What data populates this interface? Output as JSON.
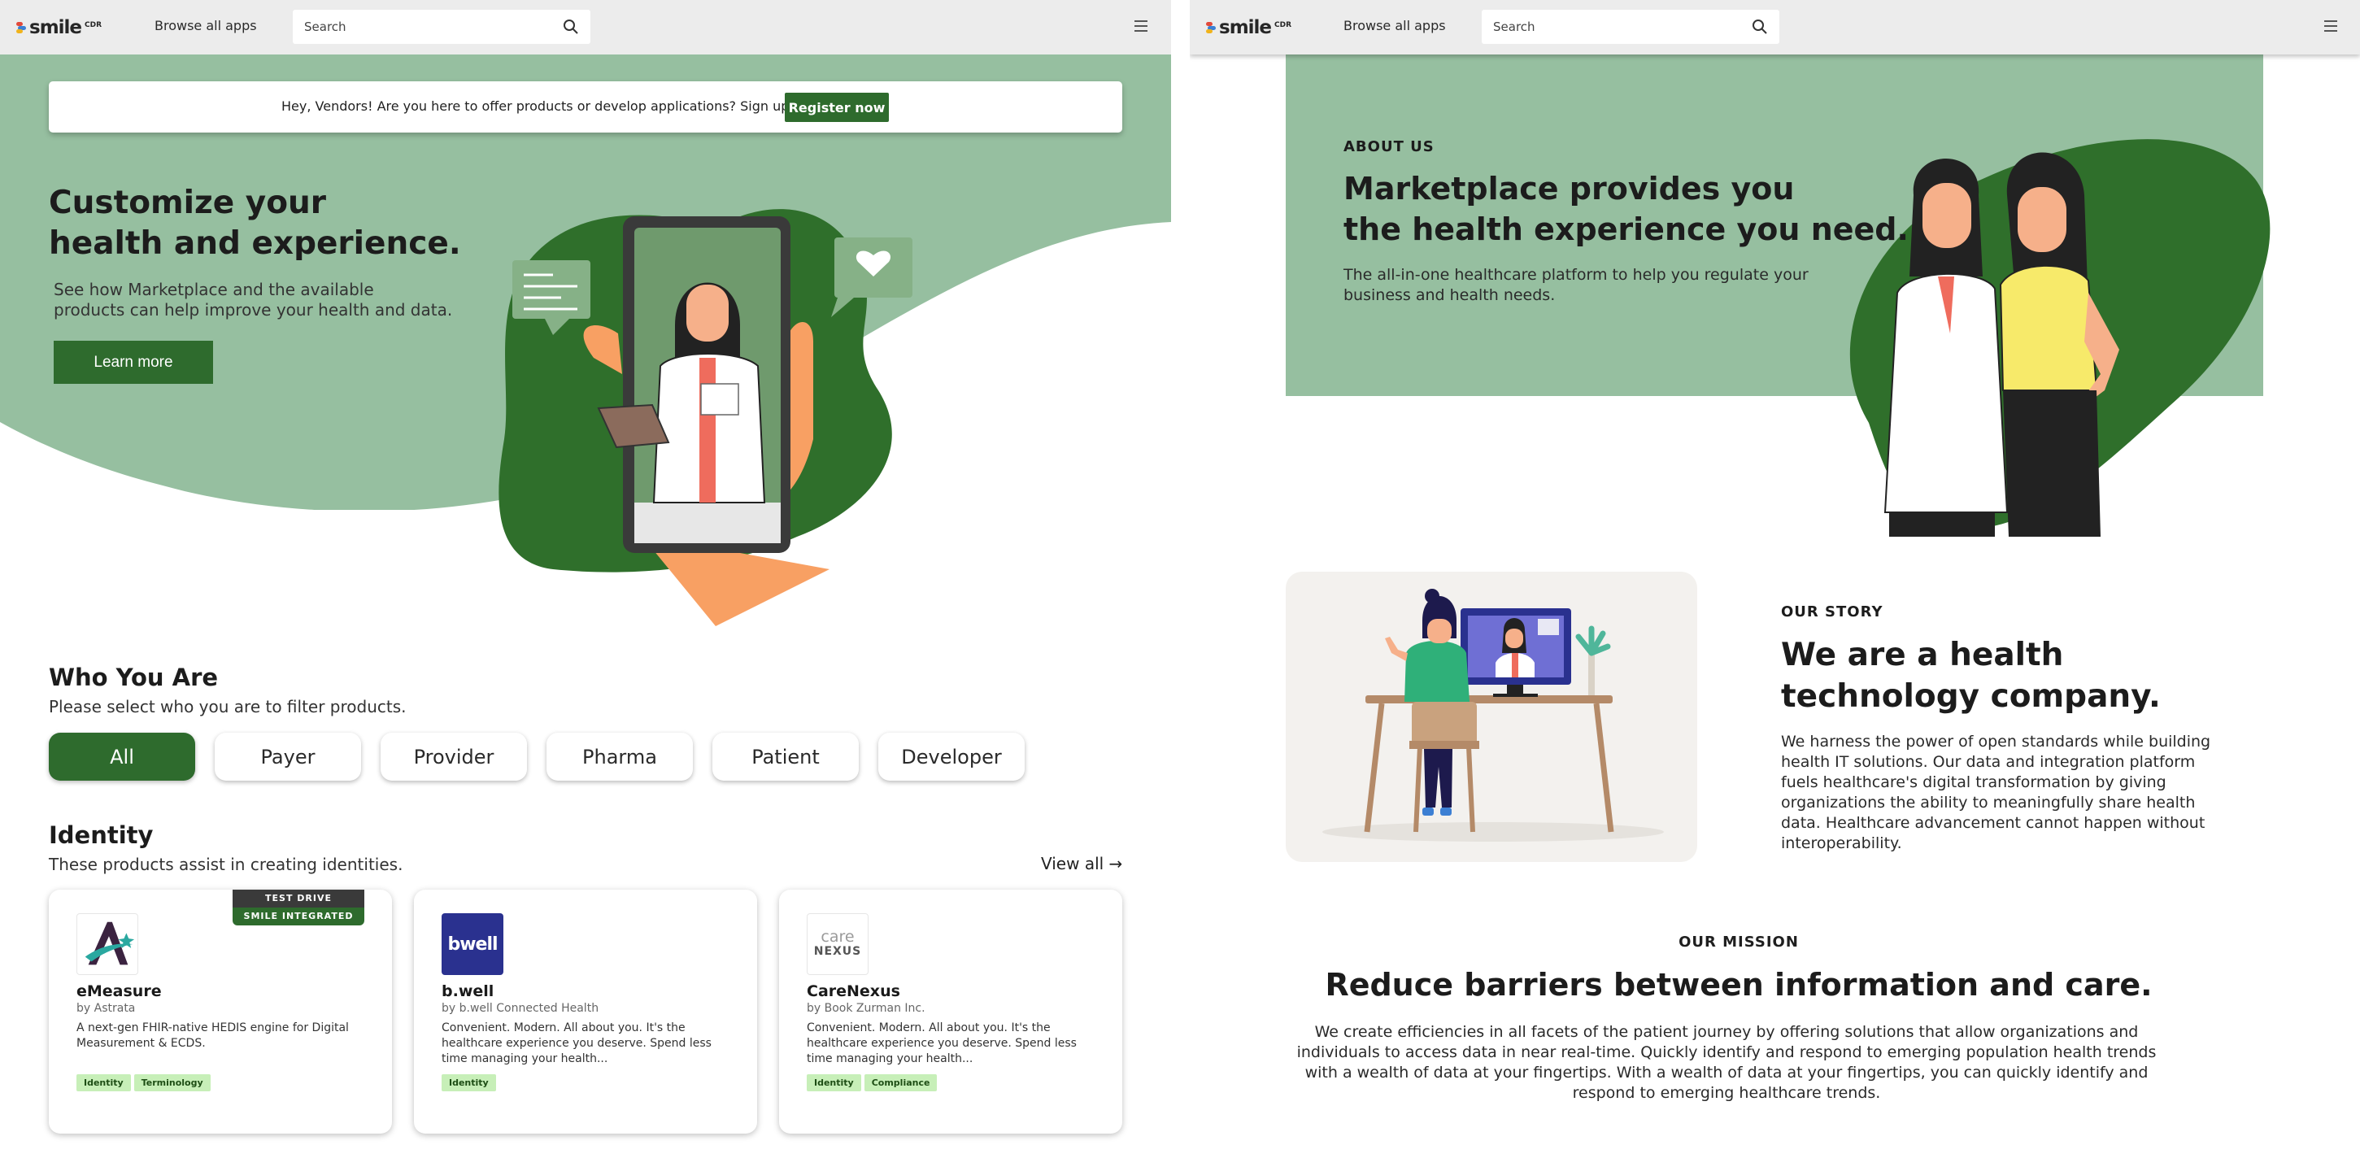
{
  "nav": {
    "logo_text": "smile",
    "logo_suffix": "CDR",
    "browse_label": "Browse all apps",
    "search_placeholder": "Search"
  },
  "vendor_banner": {
    "text": "Hey, Vendors! Are you here to offer products or develop applications? Sign up!",
    "button_label": "Register now"
  },
  "hero": {
    "title_line1": "Customize your",
    "title_line2": "health and experience.",
    "subtitle_line1": "See how Marketplace and the available",
    "subtitle_line2": "products can help improve your health and data.",
    "button_label": "Learn more"
  },
  "who": {
    "title": "Who You Are",
    "subtitle": "Please select who you are to filter products.",
    "filters": [
      "All",
      "Payer",
      "Provider",
      "Pharma",
      "Patient",
      "Developer"
    ],
    "active_filter": "All"
  },
  "identity": {
    "title": "Identity",
    "subtitle": "These products assist in creating identities.",
    "view_all": "View all →",
    "cards": [
      {
        "name": "eMeasure",
        "by": "by Astrata",
        "desc": "A next-gen FHIR-native HEDIS engine for Digital Measurement & ECDS.",
        "tags": [
          "Identity",
          "Terminology"
        ],
        "ribbon_top": "TEST DRIVE",
        "ribbon_bottom": "SMILE INTEGRATED"
      },
      {
        "name": "b.well",
        "by": "by b.well Connected Health",
        "desc": "Convenient. Modern. All about you. It's the healthcare experience you deserve. Spend less time managing your health...",
        "tags": [
          "Identity"
        ],
        "logo_text": "bwell"
      },
      {
        "name": "CareNexus",
        "by": "by Book Zurman Inc.",
        "desc": "Convenient. Modern. All about you. It's the healthcare experience you deserve. Spend less time managing your health...",
        "tags": [
          "Identity",
          "Compliance"
        ],
        "logo_text_top": "care",
        "logo_text_bottom": "NEXUS"
      }
    ]
  },
  "about": {
    "label": "ABOUT US",
    "title_line1": "Marketplace provides you",
    "title_line2": "the health experience you need.",
    "text_line1": "The all-in-one healthcare platform to help you regulate your",
    "text_line2": "business and health needs."
  },
  "story": {
    "label": "OUR STORY",
    "title": "We are a health technology company.",
    "text": "We harness the power of open standards while building health IT solutions. Our data and integration platform fuels healthcare's digital transformation by giving organizations the ability to meaningfully share health data. Healthcare advancement cannot happen without interoperability."
  },
  "mission": {
    "label": "OUR MISSION",
    "title": "Reduce barriers between information and care.",
    "text": "We create efficiencies in all facets of the patient journey by offering solutions that allow organizations and individuals to access data in near real-time. Quickly identify and respond to emerging population health trends with a wealth of data at your fingertips. With a wealth of data at your fingertips, you can quickly identify and respond to emerging healthcare trends."
  },
  "colors": {
    "brand_green": "#2e6b2d",
    "hero_green": "#96bfa0",
    "blob_green": "#2f6f2b",
    "tag_green": "#c7efb8"
  }
}
